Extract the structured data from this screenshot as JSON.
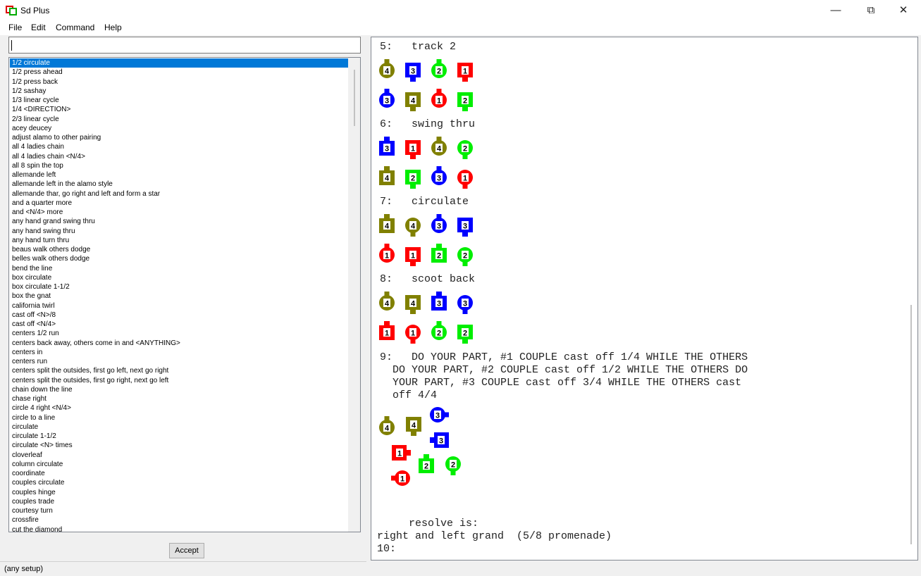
{
  "window": {
    "title": "Sd Plus",
    "buttons": {
      "minimize": "—",
      "restore": "⧉",
      "close": "✕"
    }
  },
  "menu": [
    "File",
    "Edit",
    "Command",
    "Help"
  ],
  "command_input": {
    "value": ""
  },
  "calls": [
    "1/2 circulate",
    "1/2 press ahead",
    "1/2 press back",
    "1/2 sashay",
    "1/3 linear cycle",
    "1/4 <DIRECTION>",
    "2/3 linear cycle",
    "acey deucey",
    "adjust alamo to other pairing",
    "all 4 ladies chain",
    "all 4 ladies chain <N/4>",
    "all 8 spin the top",
    "allemande left",
    "allemande left in the alamo style",
    "allemande thar, go right and left and form a star",
    "and a quarter more",
    "and <N/4> more",
    "any hand grand swing thru",
    "any hand swing thru",
    "any hand turn thru",
    "beaus walk others dodge",
    "belles walk others dodge",
    "bend the line",
    "box circulate",
    "box circulate 1-1/2",
    "box the gnat",
    "california twirl",
    "cast off <N>/8",
    "cast off <N/4>",
    "centers 1/2 run",
    "centers back away, others come in and <ANYTHING>",
    "centers in",
    "centers run",
    "centers split the outsides, first go left, next go right",
    "centers split the outsides, first go right, next go left",
    "chain down the line",
    "chase right",
    "circle 4 right <N/4>",
    "circle to a line",
    "circulate",
    "circulate 1-1/2",
    "circulate <N> times",
    "cloverleaf",
    "column circulate",
    "coordinate",
    "couples circulate",
    "couples hinge",
    "couples trade",
    "courtesy turn",
    "crossfire",
    "cut the diamond"
  ],
  "accept_label": "Accept",
  "status_text": "(any setup)",
  "colors": {
    "c1": "#ff0000",
    "c2": "#00ee00",
    "c3": "#0000ff",
    "c4": "#808000",
    "selection": "#0078d7"
  },
  "transcript": {
    "steps": [
      {
        "label": "5:   track 2",
        "rows": [
          [
            {
              "n": "4",
              "s": "girl",
              "d": "up"
            },
            {
              "n": "3",
              "s": "boy",
              "d": "down"
            },
            {
              "n": "2",
              "s": "girl",
              "d": "up"
            },
            {
              "n": "1",
              "s": "boy",
              "d": "down"
            }
          ],
          [
            {
              "n": "3",
              "s": "girl",
              "d": "up"
            },
            {
              "n": "4",
              "s": "boy",
              "d": "down"
            },
            {
              "n": "1",
              "s": "girl",
              "d": "up"
            },
            {
              "n": "2",
              "s": "boy",
              "d": "down"
            }
          ]
        ]
      },
      {
        "label": "6:   swing thru",
        "rows": [
          [
            {
              "n": "3",
              "s": "boy",
              "d": "up"
            },
            {
              "n": "1",
              "s": "boy",
              "d": "down"
            },
            {
              "n": "4",
              "s": "girl",
              "d": "up"
            },
            {
              "n": "2",
              "s": "girl",
              "d": "down"
            }
          ],
          [
            {
              "n": "4",
              "s": "boy",
              "d": "up"
            },
            {
              "n": "2",
              "s": "boy",
              "d": "down"
            },
            {
              "n": "3",
              "s": "girl",
              "d": "up"
            },
            {
              "n": "1",
              "s": "girl",
              "d": "down"
            }
          ]
        ]
      },
      {
        "label": "7:   circulate",
        "rows": [
          [
            {
              "n": "4",
              "s": "boy",
              "d": "up"
            },
            {
              "n": "4",
              "s": "girl",
              "d": "down"
            },
            {
              "n": "3",
              "s": "girl",
              "d": "up"
            },
            {
              "n": "3",
              "s": "boy",
              "d": "down"
            }
          ],
          [
            {
              "n": "1",
              "s": "girl",
              "d": "up"
            },
            {
              "n": "1",
              "s": "boy",
              "d": "down"
            },
            {
              "n": "2",
              "s": "boy",
              "d": "up"
            },
            {
              "n": "2",
              "s": "girl",
              "d": "down"
            }
          ]
        ]
      },
      {
        "label": "8:   scoot back",
        "rows": [
          [
            {
              "n": "4",
              "s": "girl",
              "d": "up"
            },
            {
              "n": "4",
              "s": "boy",
              "d": "down"
            },
            {
              "n": "3",
              "s": "boy",
              "d": "up"
            },
            {
              "n": "3",
              "s": "girl",
              "d": "down"
            }
          ],
          [
            {
              "n": "1",
              "s": "boy",
              "d": "up"
            },
            {
              "n": "1",
              "s": "girl",
              "d": "down"
            },
            {
              "n": "2",
              "s": "girl",
              "d": "up"
            },
            {
              "n": "2",
              "s": "boy",
              "d": "down"
            }
          ]
        ]
      }
    ],
    "step9_lines": [
      "9:   DO YOUR PART, #1 COUPLE cast off 1/4 WHILE THE OTHERS",
      "  DO YOUR PART, #2 COUPLE cast off 1/2 WHILE THE OTHERS DO",
      "  YOUR PART, #3 COUPLE cast off 3/4 WHILE THE OTHERS cast",
      "  off 4/4"
    ],
    "step9_dancers": [
      {
        "n": "3",
        "s": "girl",
        "d": "right"
      },
      {
        "n": "4",
        "s": "girl",
        "d": "up"
      },
      {
        "n": "4",
        "s": "boy",
        "d": "down"
      },
      {
        "n": "3",
        "s": "boy",
        "d": "left"
      },
      {
        "n": "1",
        "s": "boy",
        "d": "right"
      },
      {
        "n": "2",
        "s": "boy",
        "d": "up"
      },
      {
        "n": "2",
        "s": "girl",
        "d": "down"
      },
      {
        "n": "1",
        "s": "girl",
        "d": "left"
      }
    ],
    "resolve_label": "     resolve is:",
    "resolve_value": "right and left grand  (5/8 promenade)",
    "next_prompt": "10:"
  }
}
